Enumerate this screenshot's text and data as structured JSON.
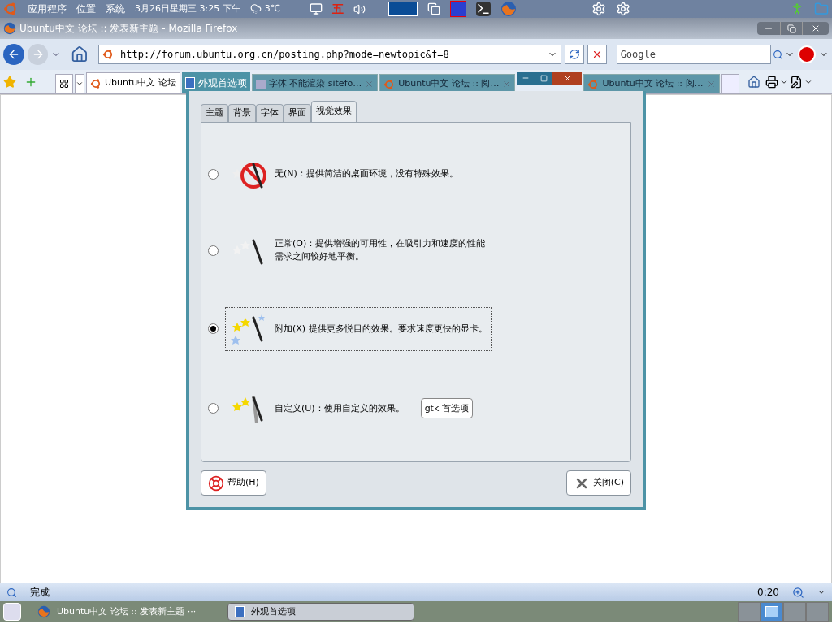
{
  "top_panel": {
    "menus": [
      "应用程序",
      "位置",
      "系统"
    ],
    "clock": "3月26日星期三 3:25 下午",
    "temperature": "3℃",
    "input_method": "五"
  },
  "browser": {
    "title": "Ubuntu中文 论坛 :: 发表新主题 - Mozilla Firefox",
    "url": "http://forum.ubuntu.org.cn/posting.php?mode=newtopic&f=8",
    "search": {
      "placeholder": "Google"
    },
    "tabs": [
      {
        "label": "Ubuntu中文 论坛",
        "selected": true
      },
      {
        "label": "字体 不能渲染 sitefo…",
        "selected": false
      },
      {
        "label": "Ubuntu中文 论坛 :: 阅…",
        "selected": false
      },
      {
        "label": "Ubuntu中文 论坛 :: 阅…",
        "selected": false
      }
    ],
    "status": "完成",
    "status_time": "0:20"
  },
  "dialog": {
    "title": "外观首选项",
    "tabs": [
      {
        "label": "主题",
        "selected": false
      },
      {
        "label": "背景",
        "selected": false
      },
      {
        "label": "字体",
        "selected": false
      },
      {
        "label": "界面",
        "selected": false
      },
      {
        "label": "视觉效果",
        "selected": true
      }
    ],
    "options": [
      {
        "kind": "none",
        "label": "无(N)：提供简洁的桌面环境，没有特殊效果。",
        "selected": false
      },
      {
        "kind": "normal",
        "label": "正常(O)：提供增强的可用性，在吸引力和速度的性能需求之间较好地平衡。",
        "selected": false
      },
      {
        "kind": "extra",
        "label": "附加(X) 提供更多悦目的效果。要求速度更快的显卡。",
        "selected": true
      },
      {
        "kind": "custom",
        "label": "自定义(U)：使用自定义的效果。",
        "selected": false,
        "button": "gtk 首选项"
      }
    ],
    "buttons": [
      {
        "kind": "help",
        "label": "帮助(H)"
      },
      {
        "kind": "close",
        "label": "关闭(C)"
      }
    ]
  },
  "taskbar": {
    "items": [
      {
        "kind": "browser",
        "label": "Ubuntu中文 论坛 :: 发表新主题 ···",
        "selected": false
      },
      {
        "kind": "dialog",
        "label": "外观首选项",
        "selected": true
      }
    ]
  },
  "workspaces": [
    {
      "selected": false
    },
    {
      "selected": true
    },
    {
      "selected": false
    },
    {
      "selected": false
    }
  ]
}
